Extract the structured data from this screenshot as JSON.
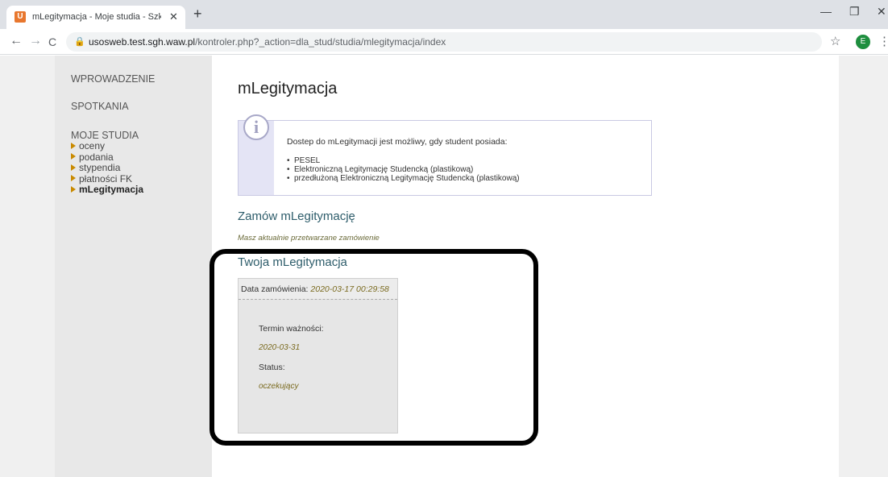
{
  "browser": {
    "tab_title": "mLegitymacja - Moje studia - Szk",
    "tab_favicon": "U",
    "tab_close": "✕",
    "new_tab": "+",
    "url_host": "usosweb.test.sgh.waw.pl",
    "url_path": "/kontroler.php?_action=dla_stud/studia/mlegitymacja/index",
    "profile_initial": "E",
    "back": "←",
    "forward": "→",
    "reload": "C",
    "minimize": "—",
    "restore": "❐",
    "close": "✕",
    "star": "☆",
    "menu": "⋮",
    "lock": "🔒"
  },
  "sidebar": {
    "sections": [
      "WPROWADZENIE",
      "SPOTKANIA",
      "MOJE STUDIA"
    ],
    "items": [
      "oceny",
      "podania",
      "stypendia",
      "płatności FK",
      "mLegitymacja"
    ],
    "active_item": "mLegitymacja"
  },
  "main": {
    "title": "mLegitymacja",
    "info": {
      "icon": "i",
      "text": "Dostep do mLegitymacji jest możliwy, gdy student posiada:",
      "requirements": [
        "PESEL",
        "Elektroniczną Legitymację Studencką (plastikową)",
        "przedłużoną Elektroniczną Legitymację Studencką (plastikową)"
      ]
    },
    "order_heading": "Zamów mLegitymację",
    "order_note": "Masz aktualnie przetwarzane zamówienie",
    "yours_heading": "Twoja mLegitymacja",
    "card": {
      "date_label": "Data zamówienia:",
      "date_value": "2020-03-17 00:29:58",
      "validity_label": "Termin ważności:",
      "validity_value": "2020-03-31",
      "status_label": "Status:",
      "status_value": "oczekujący"
    }
  },
  "colors": {
    "accent_heading": "#2e5d6b",
    "italic_value": "#7a6a1f",
    "bullet": "#c98a00",
    "highlight_border": "#000000"
  }
}
